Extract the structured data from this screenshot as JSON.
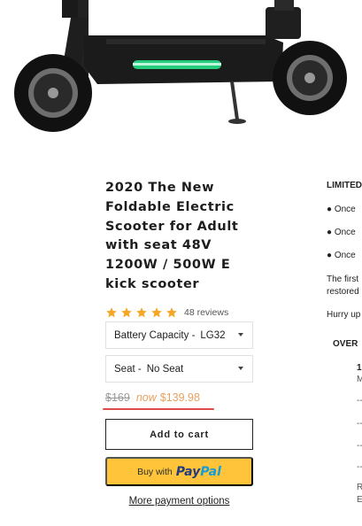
{
  "product": {
    "title": "2020 The New Foldable Electric Scooter for Adult with seat 48V 1200W / 500W E kick scooter",
    "rating": {
      "stars": 5,
      "reviews_text": "48 reviews"
    },
    "options": [
      {
        "label": "Battery Capacity -",
        "value": "LG32"
      },
      {
        "label": "Seat -",
        "value": "No Seat"
      }
    ],
    "price": {
      "old": "$169",
      "now_label": "now",
      "new": "$139.98"
    },
    "buttons": {
      "add_to_cart": "Add to cart",
      "paypal_prefix": "Buy with",
      "paypal_logo_a": "Pay",
      "paypal_logo_b": "Pal",
      "more_payment": "More payment options"
    }
  },
  "side_panel": {
    "heading": "LIMITED",
    "bullets": [
      "● Once",
      "● Once",
      "● Once"
    ],
    "para_line1": "The first",
    "para_line2": "restored",
    "hurry": "Hurry up",
    "overview_heading": "OVER",
    "detail_num": "1",
    "detail_letter": "M",
    "dashes": [
      "--",
      "--",
      "--",
      "--"
    ],
    "bottom_1": "R",
    "bottom_2": "E"
  },
  "colors": {
    "star": "#f5a623",
    "sale_price": "#e8a15f",
    "highlight_underline": "#e04a4a",
    "paypal_button": "#ffc439",
    "deck_light": "#27e08a"
  }
}
